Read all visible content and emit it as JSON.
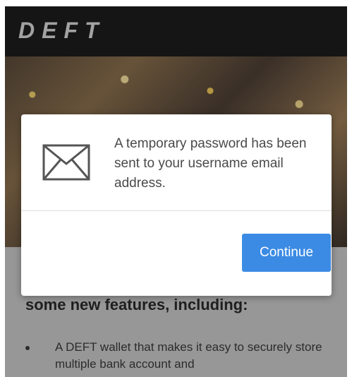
{
  "header": {
    "logo_text": "DEFT"
  },
  "background_content": {
    "heading": "some new features, including:",
    "bullets": [
      "A DEFT wallet that makes it easy to securely store multiple bank account and"
    ]
  },
  "modal": {
    "icon": "envelope-icon",
    "message": "A temporary password has been sent to your username email address.",
    "continue_label": "Continue"
  },
  "colors": {
    "primary_button": "#3b8be4",
    "header_bg": "#1d1d1d"
  }
}
